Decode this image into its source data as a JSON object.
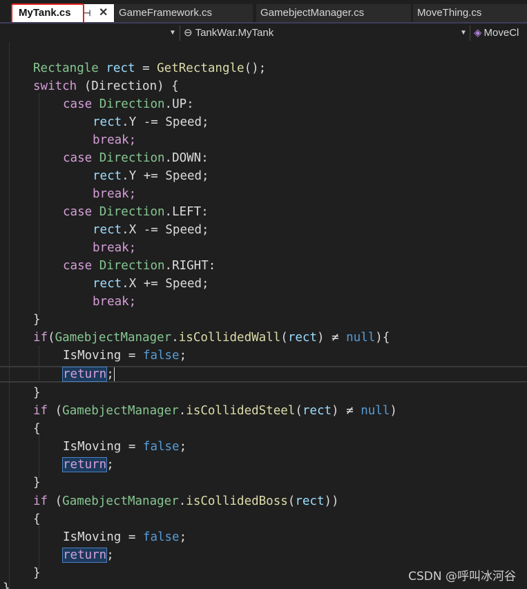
{
  "tabs": [
    {
      "label": "MyTank.cs",
      "active": true
    },
    {
      "label": "GameFramework.cs"
    },
    {
      "label": "GamebjectManager.cs"
    },
    {
      "label": "MoveThing.cs"
    }
  ],
  "nav": {
    "namespace_value": "",
    "class_value": "TankWar.MyTank",
    "member_value": "MoveCl"
  },
  "code": {
    "l1": {
      "type": "Rectangle",
      "var": "rect",
      "op": " = ",
      "method": "GetRectangle",
      "tail": "();"
    },
    "l2": {
      "kw": "switch",
      "rest": " (Direction) {"
    },
    "c_up": {
      "kw": "case",
      "type": "Direction",
      "rest": ".UP:"
    },
    "up_stmt": {
      "var": "rect",
      "rest": ".Y -= Speed;"
    },
    "up_break": "break;",
    "c_down": {
      "kw": "case",
      "type": "Direction",
      "rest": ".DOWN:"
    },
    "down_stmt": {
      "var": "rect",
      "rest": ".Y += Speed;"
    },
    "down_break": "break;",
    "c_left": {
      "kw": "case",
      "type": "Direction",
      "rest": ".LEFT:"
    },
    "left_stmt": {
      "var": "rect",
      "rest": ".X -= Speed;"
    },
    "left_break": "break;",
    "c_right": {
      "kw": "case",
      "type": "Direction",
      "rest": ".RIGHT:"
    },
    "right_stmt": {
      "var": "rect",
      "rest": ".X += Speed;"
    },
    "right_break": "break;",
    "close_switch": "}",
    "if1": {
      "kw": "if",
      "open": "(",
      "type": "GamebjectManager",
      "dot": ".",
      "method": "isCollidedWall",
      "args": "(",
      "var": "rect",
      "cmp": ") ≠ ",
      "null": "null",
      "tail": "){"
    },
    "if1_body": {
      "prop": "IsMoving",
      "eq": " = ",
      "val": "false",
      "semi": ";"
    },
    "if1_ret": {
      "kw": "return",
      "semi": ";"
    },
    "if1_close": "}",
    "if2": {
      "kw": "if",
      "open": " (",
      "type": "GamebjectManager",
      "dot": ".",
      "method": "isCollidedSteel",
      "args": "(",
      "var": "rect",
      "cmp": ") ≠ ",
      "null": "null",
      "tail": ")"
    },
    "if2_open": "{",
    "if2_body": {
      "prop": "IsMoving",
      "eq": " = ",
      "val": "false",
      "semi": ";"
    },
    "if2_ret": {
      "kw": "return",
      "semi": ";"
    },
    "if2_close": "}",
    "if3": {
      "kw": "if",
      "open": " (",
      "type": "GamebjectManager",
      "dot": ".",
      "method": "isCollidedBoss",
      "args": "(",
      "var": "rect",
      "tail": "))"
    },
    "if3_open": "{",
    "if3_body": {
      "prop": "IsMoving",
      "eq": " = ",
      "val": "false",
      "semi": ";"
    },
    "if3_ret": {
      "kw": "return",
      "semi": ";"
    },
    "if3_close": "}",
    "last": "}"
  },
  "watermark": "CSDN @呼叫冰河谷"
}
